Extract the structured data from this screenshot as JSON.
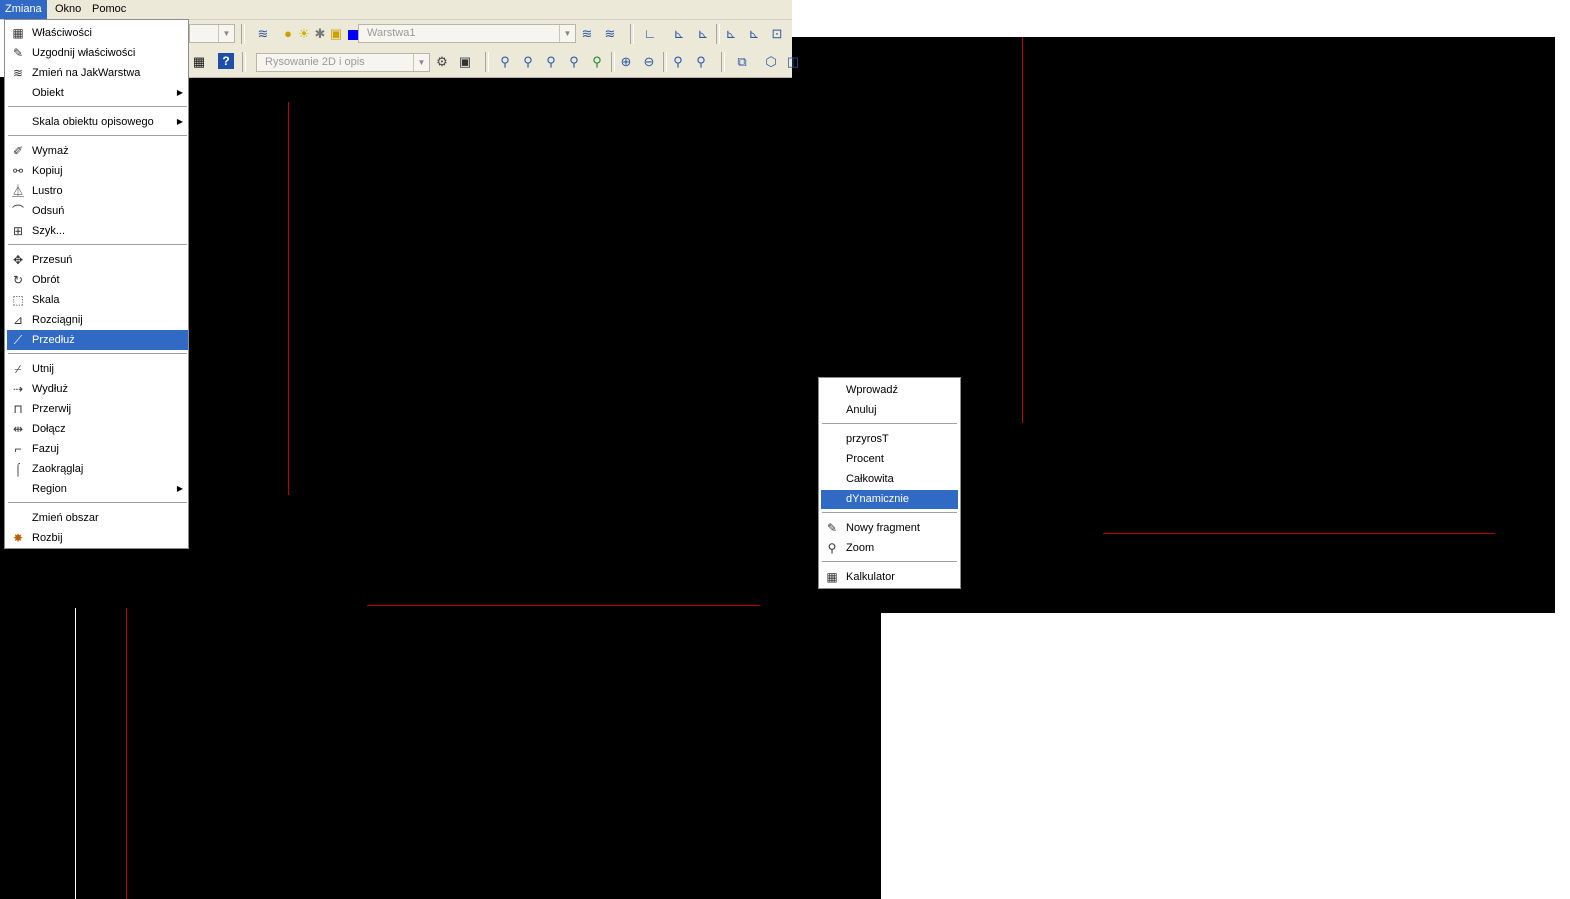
{
  "menubar": {
    "items": [
      {
        "label": "Zmiana",
        "active": true
      },
      {
        "label": "Okno",
        "active": false
      },
      {
        "label": "Pomoc",
        "active": false
      }
    ]
  },
  "toolbar": {
    "layer_combo": "Warstwa1",
    "workspace_combo": "Rysowanie 2D i opis"
  },
  "dropdown_menu": {
    "items": [
      {
        "label": "Właściwości",
        "icon": "properties-icon",
        "glyph": "▦"
      },
      {
        "label": "Uzgodnij właściwości",
        "icon": "match-properties-icon",
        "glyph": "✎"
      },
      {
        "label": "Zmień na JakWarstwa",
        "icon": "change-to-bylayer-icon",
        "glyph": "≋"
      },
      {
        "label": "Obiekt",
        "icon": "",
        "glyph": "",
        "submenu": true
      },
      {
        "label": "Skala obiektu opisowego",
        "icon": "",
        "glyph": "",
        "submenu": true
      },
      {
        "label": "Wymaż",
        "icon": "erase-icon",
        "glyph": "✐"
      },
      {
        "label": "Kopiuj",
        "icon": "copy-icon",
        "glyph": "⚯"
      },
      {
        "label": "Lustro",
        "icon": "mirror-icon",
        "glyph": "⏅"
      },
      {
        "label": "Odsuń",
        "icon": "offset-icon",
        "glyph": "⌒"
      },
      {
        "label": "Szyk...",
        "icon": "array-icon",
        "glyph": "⊞"
      },
      {
        "label": "Przesuń",
        "icon": "move-icon",
        "glyph": "✥"
      },
      {
        "label": "Obrót",
        "icon": "rotate-icon",
        "glyph": "↻"
      },
      {
        "label": "Skala",
        "icon": "scale-icon",
        "glyph": "⬚"
      },
      {
        "label": "Rozciągnij",
        "icon": "stretch-icon",
        "glyph": "⊿"
      },
      {
        "label": "Przedłuż",
        "icon": "lengthen-icon",
        "glyph": "⟋",
        "highlighted": true
      },
      {
        "label": "Utnij",
        "icon": "trim-icon",
        "glyph": "⌿"
      },
      {
        "label": "Wydłuż",
        "icon": "extend-icon",
        "glyph": "⇢"
      },
      {
        "label": "Przerwij",
        "icon": "break-icon",
        "glyph": "⊓"
      },
      {
        "label": "Dołącz",
        "icon": "join-icon",
        "glyph": "⇹"
      },
      {
        "label": "Fazuj",
        "icon": "chamfer-icon",
        "glyph": "⌐"
      },
      {
        "label": "Zaokrąglaj",
        "icon": "fillet-icon",
        "glyph": "⌠"
      },
      {
        "label": "Region",
        "icon": "",
        "glyph": "",
        "submenu": true
      },
      {
        "label": "Zmień obszar",
        "icon": "",
        "glyph": ""
      },
      {
        "label": "Rozbij",
        "icon": "explode-icon",
        "glyph": "✸"
      }
    ]
  },
  "context_menu": {
    "items": [
      {
        "label": "Wprowadź",
        "icon": "",
        "glyph": ""
      },
      {
        "label": "Anuluj",
        "icon": "",
        "glyph": ""
      },
      {
        "label": "przyrosT",
        "icon": "",
        "glyph": ""
      },
      {
        "label": "Procent",
        "icon": "",
        "glyph": ""
      },
      {
        "label": "Całkowita",
        "icon": "",
        "glyph": ""
      },
      {
        "label": "dYnamicznie",
        "icon": "",
        "glyph": "",
        "highlighted": true
      },
      {
        "label": "Nowy fragment",
        "icon": "new-fragment-icon",
        "glyph": "✎"
      },
      {
        "label": "Zoom",
        "icon": "zoom-icon",
        "glyph": "⚲"
      },
      {
        "label": "Kalkulator",
        "icon": "calculator-icon",
        "glyph": "▦"
      }
    ]
  },
  "colors": {
    "highlight": "#316ac5",
    "canvas": "#000000",
    "drawing_line": "#c00000",
    "menubar": "#ece9d8"
  }
}
